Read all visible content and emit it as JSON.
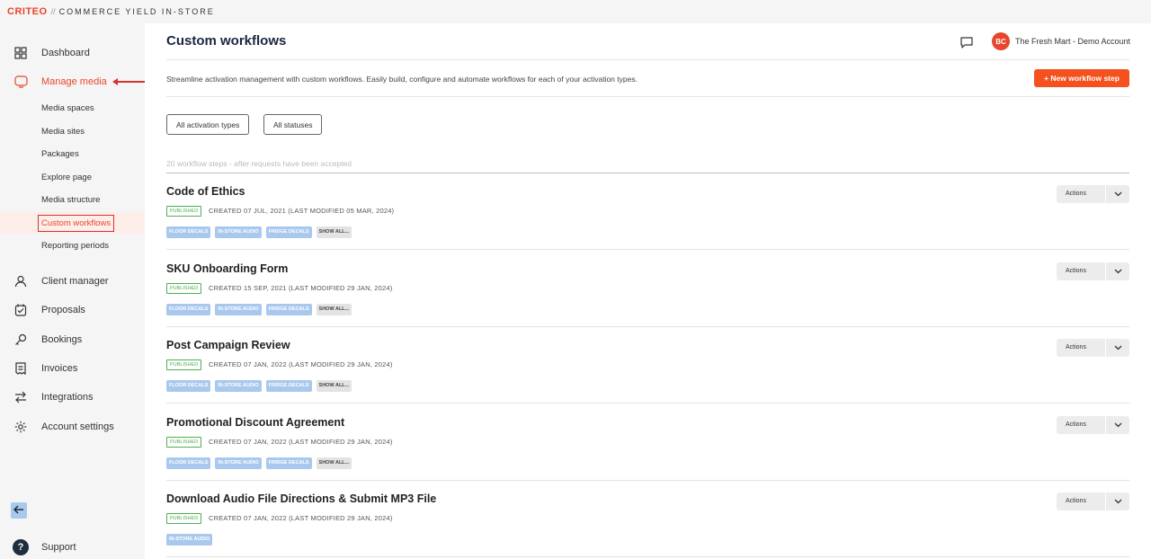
{
  "brand": {
    "logo": "CRITEO",
    "separator": "//",
    "product": "COMMERCE YIELD IN-STORE"
  },
  "sidebar": {
    "items": [
      {
        "label": "Dashboard",
        "icon": "grid-icon"
      },
      {
        "label": "Manage media",
        "icon": "monitor-icon",
        "active": true
      },
      {
        "label": "Client manager",
        "icon": "user-icon"
      },
      {
        "label": "Proposals",
        "icon": "proposal-icon"
      },
      {
        "label": "Bookings",
        "icon": "key-icon"
      },
      {
        "label": "Invoices",
        "icon": "invoice-icon"
      },
      {
        "label": "Integrations",
        "icon": "arrows-icon"
      },
      {
        "label": "Account settings",
        "icon": "gear-icon"
      }
    ],
    "sub_items": [
      {
        "label": "Media spaces"
      },
      {
        "label": "Media sites"
      },
      {
        "label": "Packages"
      },
      {
        "label": "Explore page"
      },
      {
        "label": "Media structure"
      },
      {
        "label": "Custom workflows",
        "active": true
      },
      {
        "label": "Reporting periods"
      }
    ],
    "support_label": "Support",
    "support_glyph": "?"
  },
  "header": {
    "title": "Custom workflows",
    "account_initials": "BC",
    "account_name": "The Fresh Mart - Demo Account"
  },
  "description": "Streamline activation management with custom workflows. Easily build, configure and automate workflows for each of your activation types.",
  "new_button_label": "+ New workflow step",
  "filters": {
    "activation_types": "All activation types",
    "statuses": "All statuses"
  },
  "count_text": "20 workflow steps - after requests have been accepted",
  "actions_label": "Actions",
  "show_all_label": "SHOW ALL...",
  "workflows": [
    {
      "title": "Code of Ethics",
      "status": "PUBLISHED",
      "created": "CREATED 07 JUL, 2021 (LAST MODIFIED 05 MAR, 2024)",
      "tags": [
        "FLOOR DECALS",
        "IN-STORE AUDIO",
        "FRIDGE DECALS"
      ]
    },
    {
      "title": "SKU Onboarding Form",
      "status": "PUBLISHED",
      "created": "CREATED 15 SEP, 2021 (LAST MODIFIED 29 JAN, 2024)",
      "tags": [
        "FLOOR DECALS",
        "IN-STORE AUDIO",
        "FRIDGE DECALS"
      ]
    },
    {
      "title": "Post Campaign Review",
      "status": "PUBLISHED",
      "created": "CREATED 07 JAN, 2022 (LAST MODIFIED 29 JAN, 2024)",
      "tags": [
        "FLOOR DECALS",
        "IN-STORE AUDIO",
        "FRIDGE DECALS"
      ]
    },
    {
      "title": "Promotional Discount Agreement",
      "status": "PUBLISHED",
      "created": "CREATED 07 JAN, 2022 (LAST MODIFIED 29 JAN, 2024)",
      "tags": [
        "FLOOR DECALS",
        "IN-STORE AUDIO",
        "FRIDGE DECALS"
      ]
    },
    {
      "title": "Download Audio File Directions & Submit MP3 File",
      "status": "PUBLISHED",
      "created": "CREATED 07 JAN, 2022 (LAST MODIFIED 29 JAN, 2024)",
      "tags": [
        "IN-STORE AUDIO"
      ]
    }
  ],
  "colors": {
    "accent": "#e8462c",
    "button": "#f4511e",
    "tag": "#a9c8ee",
    "status": "#4caf50",
    "title": "#1a2640"
  }
}
